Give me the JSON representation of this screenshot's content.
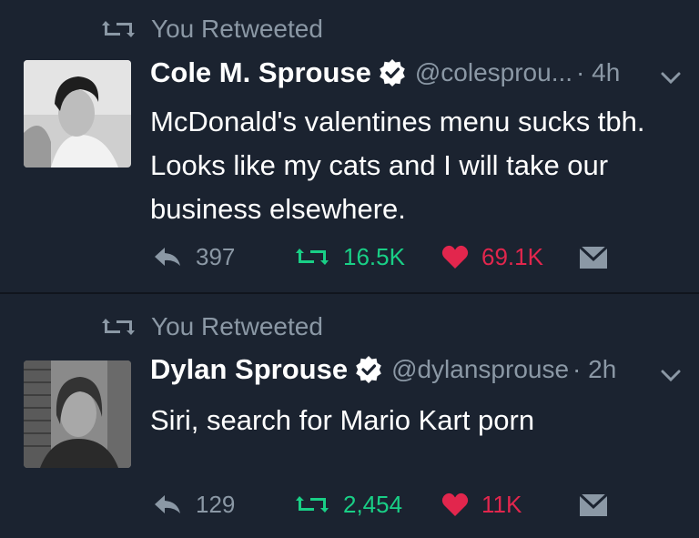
{
  "colors": {
    "background": "#1b2330",
    "muted": "#8b98a5",
    "retweet": "#19cf86",
    "like": "#e2264d",
    "verified": "#ffffff"
  },
  "tweets": [
    {
      "retweet_label": "You Retweeted",
      "name": "Cole M. Sprouse",
      "handle": "@colesprou...",
      "time": "· 4h",
      "text": "McDonald's valentines menu sucks tbh. Looks like my cats and I will take our business elsewhere.",
      "replies": "397",
      "retweets": "16.5K",
      "likes": "69.1K"
    },
    {
      "retweet_label": "You Retweeted",
      "name": "Dylan Sprouse",
      "handle": "@dylansprouse",
      "time": "· 2h",
      "text": "Siri, search for Mario Kart porn",
      "replies": "129",
      "retweets": "2,454",
      "likes": "11K"
    }
  ]
}
